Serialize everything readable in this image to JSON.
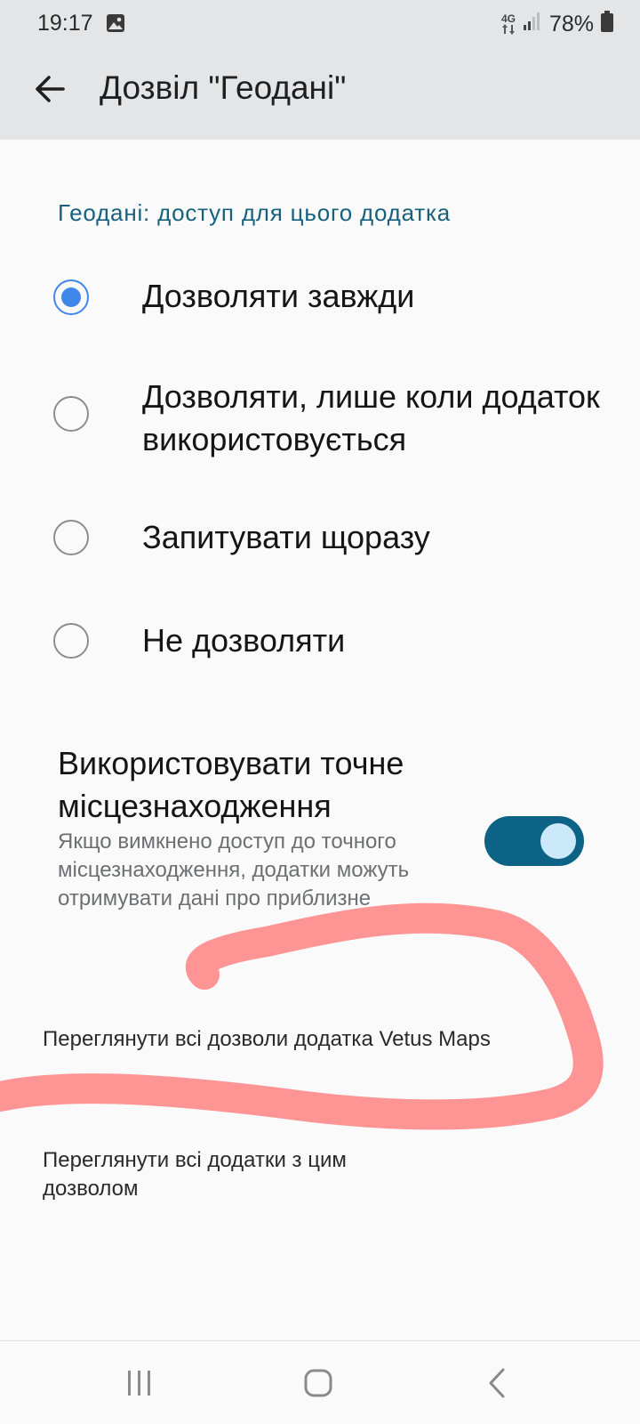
{
  "status_bar": {
    "time": "19:17",
    "network_type": "4G",
    "battery_percent": "78%",
    "icons": [
      "gallery-icon",
      "data-arrows-icon",
      "signal-icon",
      "battery-icon"
    ]
  },
  "app_bar": {
    "title": "Дозвіл \"Геодані\""
  },
  "section": {
    "header": "Геодані: доступ для цього додатка"
  },
  "options": [
    {
      "label": "Дозволяти завжди",
      "selected": true
    },
    {
      "label": "Дозволяти, лише коли додаток використовується",
      "selected": false
    },
    {
      "label": "Запитувати щоразу",
      "selected": false
    },
    {
      "label": "Не дозволяти",
      "selected": false
    }
  ],
  "precise_location": {
    "title": "Використовувати точне місцезнаходження",
    "description": "Якщо вимкнено доступ до точного місцезнаходження, додатки можуть отримувати дані про приблизне",
    "enabled": true
  },
  "links": {
    "app_permissions": "Переглянути всі дозволи додатка Vetus Maps",
    "apps_with_permission": "Переглянути всі додатки з цим дозволом"
  },
  "colors": {
    "accent": "#17617c",
    "radio_selected": "#3f87e9",
    "toggle_on": "#0c6386",
    "scribble": "#ff8b8b"
  },
  "nav_bar": {
    "icons": [
      "recents-icon",
      "home-icon",
      "back-nav-icon"
    ]
  }
}
